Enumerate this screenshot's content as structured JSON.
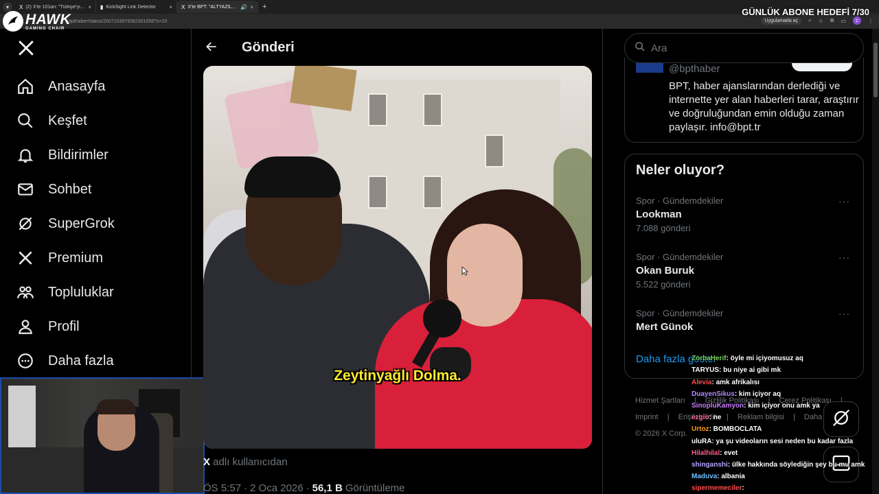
{
  "browser": {
    "tabs": [
      {
        "icon": "X",
        "title": "(2) X'te 101an: \"Türkiye'yi ziyaret...",
        "close": "×"
      },
      {
        "icon": "",
        "title": "KickSight Link Detector",
        "close": "×"
      },
      {
        "icon": "X",
        "title": "X'te BPT: \"ALTYAZILI | Ash B...",
        "close": "×"
      }
    ],
    "new_tab": "+",
    "url": "bpthaber/status/2007103979382301058?s=20",
    "app_button": "Uygulamada aç",
    "avatar_letter": "c"
  },
  "stream": {
    "logo_text": "HAWK",
    "logo_sub": "GAMING CHAIR",
    "goal_text": "GÜNLÜK ABONE HEDEFİ 7/30"
  },
  "nav": {
    "items": [
      {
        "label": "Anasayfa"
      },
      {
        "label": "Keşfet"
      },
      {
        "label": "Bildirimler"
      },
      {
        "label": "Sohbet"
      },
      {
        "label": "SuperGrok"
      },
      {
        "label": "Premium"
      },
      {
        "label": "Topluluklar"
      },
      {
        "label": "Profil"
      },
      {
        "label": "Daha fazla"
      }
    ]
  },
  "main": {
    "title": "Gönderi",
    "subtitle_text": "Zeytinyağlı Dolma.",
    "from_prefix": "X",
    "from_text": " adlı kullanıcıdan",
    "time": "ÖS 5:57",
    "sep": "·",
    "date": "2 Oca 2026",
    "views": "56,1 B",
    "views_label": "Görüntüleme"
  },
  "right": {
    "search_placeholder": "Ara",
    "bio_handle": "@bpthaber",
    "bio_text": "BPT, haber ajanslarından derlediği ve internette yer alan haberleri tarar, araştırır ve doğruluğundan emin olduğu zaman paylaşır. info@bpt.tr",
    "trends_title": "Neler oluyor?",
    "trends": [
      {
        "context": "Spor · Gündemdekiler",
        "name": "Lookman",
        "count": "7.088 gönderi"
      },
      {
        "context": "Spor · Gündemdekiler",
        "name": "Okan Buruk",
        "count": "5.522 gönderi"
      },
      {
        "context": "Spor · Gündemdekiler",
        "name": "Mert Günok",
        "count": ""
      }
    ],
    "trend_more": "···",
    "show_more": "Daha fazla göster",
    "footer_line1": [
      "Hizmet Şartları",
      "|",
      "Gizlilik Politikası",
      "|",
      "Çerez Politikası",
      "|"
    ],
    "footer_line2": [
      "Imprint",
      "|",
      "Erişilebilirlik",
      "|",
      "Reklam bilgisi",
      "|",
      "Daha fazla"
    ],
    "footer_copy": "© 2026 X Corp."
  },
  "chat": [
    {
      "user": "",
      "msg": "",
      "color": "#ff66aa"
    },
    {
      "user": "ZorbaHerif",
      "msg": ": öyle mi içiyomusuz aq",
      "color": "#7bd35a"
    },
    {
      "user": "TARYUS",
      "msg": ": bu niye ai gibi mk",
      "color": "#ffffff"
    },
    {
      "user": "Alevia",
      "msg": ": amk afrikalısı",
      "color": "#ff4d4d"
    },
    {
      "user": "DuayenSikus",
      "msg": ": kim içiyor aq",
      "color": "#b388ff"
    },
    {
      "user": "SinopluKamyon",
      "msg": ": kim içiyor onu amk ya",
      "color": "#c77dff"
    },
    {
      "user": "ezgio",
      "msg": ": ne",
      "color": "#ff6b9d"
    },
    {
      "user": "Urtoz",
      "msg": ": BOMBOCLATA",
      "color": "#ff9f1c"
    },
    {
      "user": "uluRA",
      "msg": ": ya şu videoların sesi neden bu kadar fazla",
      "color": "#ffffff"
    },
    {
      "user": "Hilalhilal",
      "msg": ": evet",
      "color": "#ff5c8a"
    },
    {
      "user": "shinganshi",
      "msg": ": ülke hakkında söylediğin şey bu mu amk",
      "color": "#b7a4ff"
    },
    {
      "user": "Maduva",
      "msg": ": albania",
      "color": "#6ec3ff"
    },
    {
      "user": "sipermemeciler",
      "msg": ":",
      "color": "#ff4d4d"
    }
  ],
  "colors": {
    "accent": "#1d9bf0",
    "background": "#000000",
    "subtitle": "#ffe92e"
  }
}
